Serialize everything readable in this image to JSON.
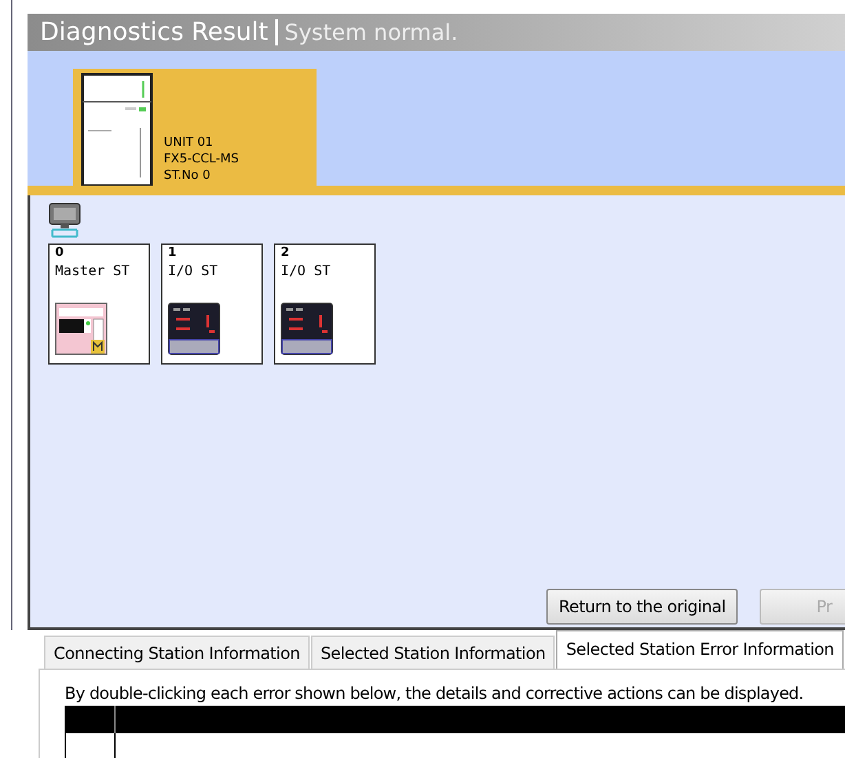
{
  "header": {
    "title": "Diagnostics Result",
    "status": "System normal."
  },
  "unit": {
    "lines": [
      "UNIT 01",
      "FX5-CCL-MS",
      "ST.No 0"
    ],
    "selected": true
  },
  "stations": [
    {
      "number": "0",
      "label": "Master ST",
      "kind": "master"
    },
    {
      "number": "1",
      "label": "I/O ST",
      "kind": "io"
    },
    {
      "number": "2",
      "label": "I/O ST",
      "kind": "io"
    }
  ],
  "buttons": [
    {
      "label": "Return to the original",
      "disabled": false
    },
    {
      "label": "Pr",
      "disabled": true
    }
  ],
  "tabs": [
    {
      "label": "Connecting Station Information",
      "selected": false
    },
    {
      "label": "Selected Station Information",
      "selected": false
    },
    {
      "label": "Selected Station Error Information",
      "selected": true
    }
  ],
  "hint": "By double-clicking each error shown below, the details and corrective actions can be displayed."
}
